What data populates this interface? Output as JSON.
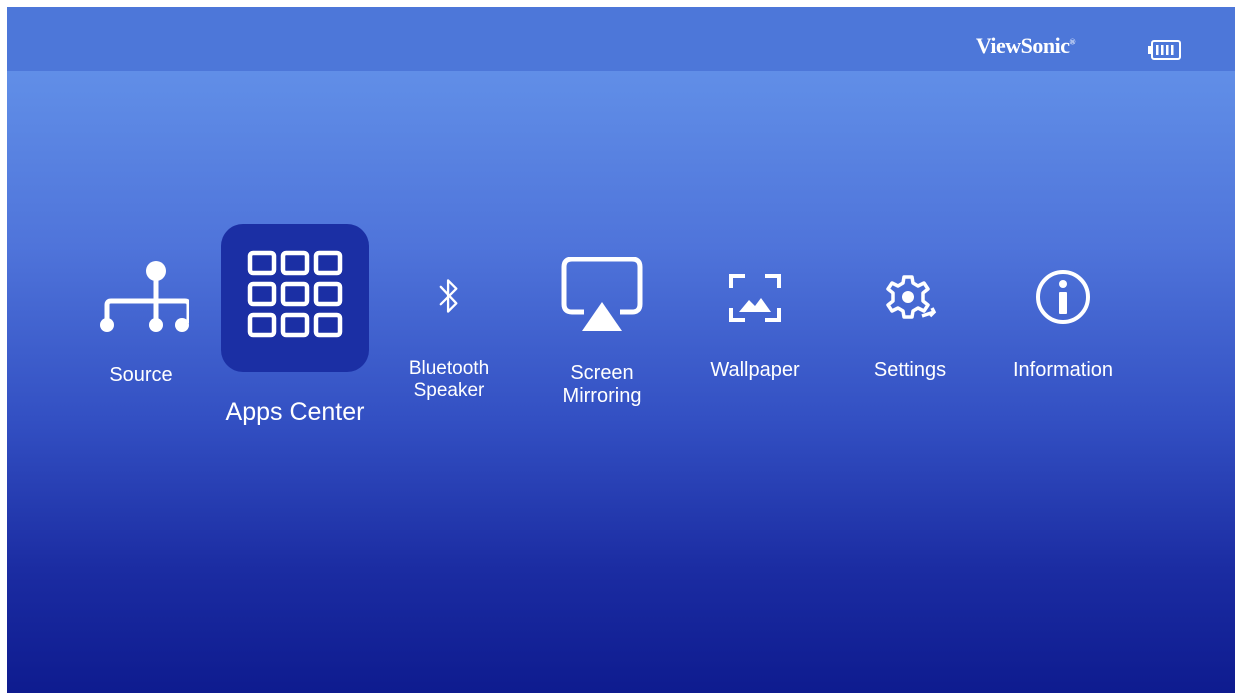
{
  "brand": {
    "name": "ViewSonic",
    "mark": "®"
  },
  "status": {
    "battery_icon": "battery-full-icon"
  },
  "menu": {
    "items": [
      {
        "id": "source",
        "label": "Source",
        "icon": "source-tree-icon"
      },
      {
        "id": "apps-center",
        "label": "Apps Center",
        "icon": "apps-grid-icon",
        "selected": true
      },
      {
        "id": "bluetooth-speaker",
        "label": "Bluetooth\nSpeaker",
        "icon": "bluetooth-icon"
      },
      {
        "id": "screen-mirroring",
        "label": "Screen\nMirroring",
        "icon": "screen-mirroring-icon"
      },
      {
        "id": "wallpaper",
        "label": "Wallpaper",
        "icon": "wallpaper-icon"
      },
      {
        "id": "settings",
        "label": "Settings",
        "icon": "gear-icon"
      },
      {
        "id": "information",
        "label": "Information",
        "icon": "info-icon"
      }
    ]
  },
  "colors": {
    "topbar": "#4d77d9",
    "selected_tile": "#1b2fa4",
    "text": "#ffffff"
  }
}
